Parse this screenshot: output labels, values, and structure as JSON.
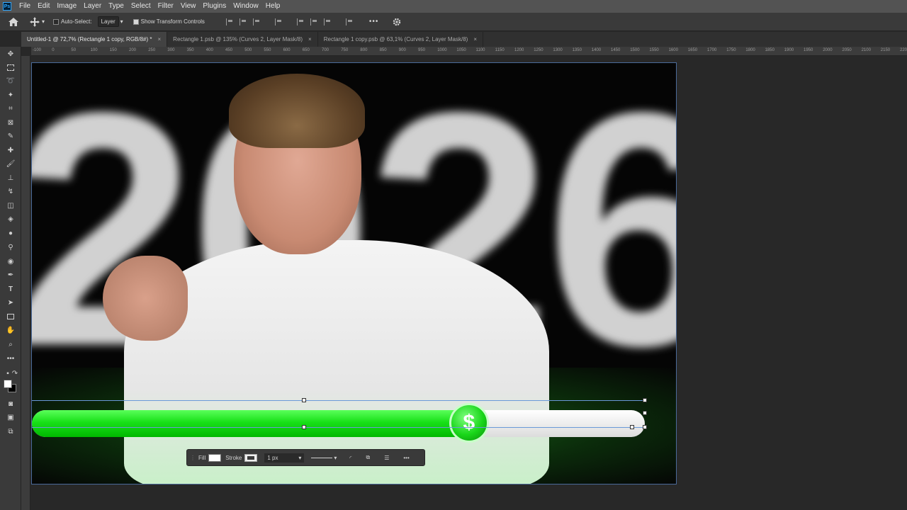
{
  "menu": [
    "File",
    "Edit",
    "Image",
    "Layer",
    "Type",
    "Select",
    "Filter",
    "View",
    "Plugins",
    "Window",
    "Help"
  ],
  "app_logo": "Ps",
  "options": {
    "auto_select": "Auto-Select:",
    "layer_dropdown": "Layer",
    "show_transform": "Show Transform Controls",
    "more": "•••"
  },
  "tabs": [
    {
      "label": "Untitled-1 @ 72,7% (Rectangle 1 copy, RGB/8#) *",
      "active": true
    },
    {
      "label": "Rectangle 1.psb @ 135% (Curves 2, Layer Mask/8)",
      "active": false
    },
    {
      "label": "Rectangle 1 copy.psb @ 63,1% (Curves 2, Layer Mask/8)",
      "active": false
    }
  ],
  "ruler_ticks": [
    "-100",
    "0",
    "50",
    "100",
    "150",
    "200",
    "250",
    "300",
    "350",
    "400",
    "450",
    "500",
    "550",
    "600",
    "650",
    "700",
    "750",
    "800",
    "850",
    "900",
    "950",
    "1000",
    "1050",
    "1100",
    "1150",
    "1200",
    "1250",
    "1300",
    "1350",
    "1400",
    "1450",
    "1500",
    "1550",
    "1600",
    "1650",
    "1700",
    "1750",
    "1800",
    "1850",
    "1900",
    "1950",
    "2000",
    "2050",
    "2100",
    "2150",
    "2200",
    "2250",
    "2300",
    "2350",
    "2400",
    "2450",
    "2500"
  ],
  "canvas": {
    "big_text": "2026",
    "coin_symbol": "$",
    "progress": 0.72
  },
  "context_bar": {
    "fill_label": "Fill",
    "stroke_label": "Stroke",
    "stroke_width": "1 px",
    "more": "•••"
  },
  "colors": {
    "accent_green": "#18e018",
    "selection_blue": "#6a9ad8"
  }
}
